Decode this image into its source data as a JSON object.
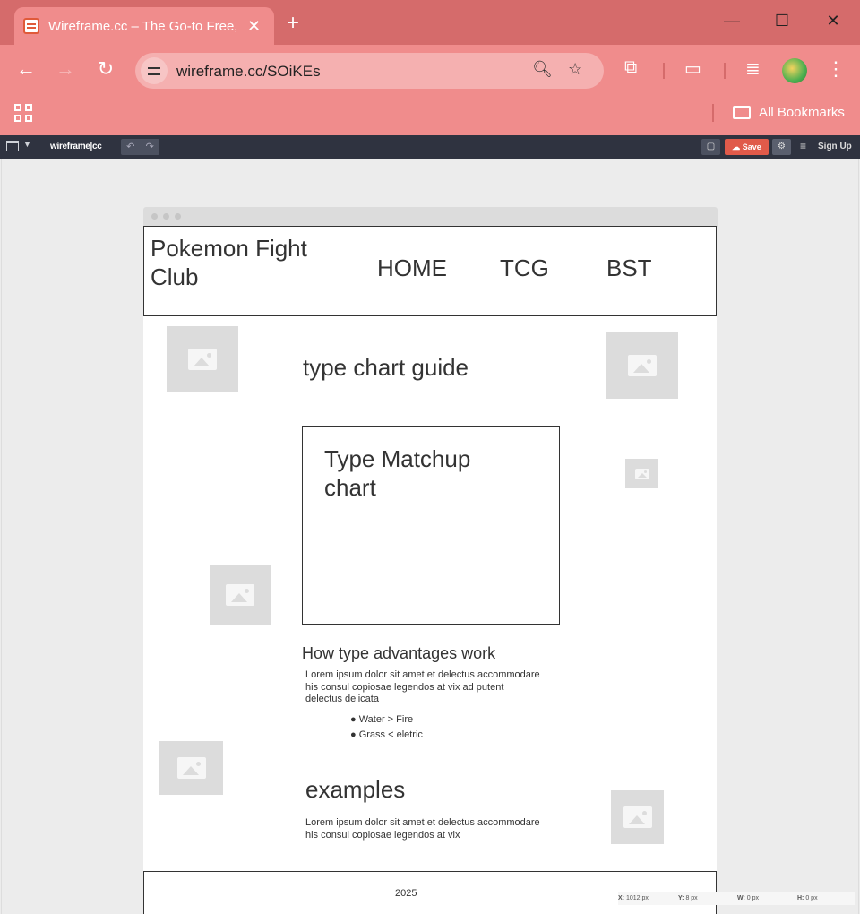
{
  "browser": {
    "tab_title": "Wireframe.cc – The Go-to Free, ",
    "tab_close": "✕",
    "new_tab": "+",
    "url": "wireframe.cc/SOiKEs",
    "bookmarks_label": "All Bookmarks",
    "window_controls": {
      "minimize": "—",
      "maximize": "☐",
      "close": "✕"
    }
  },
  "appbar": {
    "logo": "wireframe|cc",
    "undo": "↶",
    "redo": "↷",
    "save_label": "Save",
    "menu_icon": "≡",
    "signup_label": "Sign Up"
  },
  "wireframe": {
    "site_title": "Pokemon Fight Club",
    "nav": [
      "HOME",
      "TCG",
      "BST"
    ],
    "guide_heading": "type chart guide",
    "chart_box_title": "Type Matchup chart",
    "advantages_heading": "How type advantages work",
    "advantages_paragraph": "Lorem ipsum dolor sit amet et delectus accommodare his consul copiosae legendos at vix ad putent delectus delicata",
    "bullets": [
      "● Water > Fire",
      "● Grass < eletric"
    ],
    "examples_heading": "examples",
    "examples_paragraph": "Lorem ipsum dolor sit amet et delectus accommodare his consul copiosae legendos at vix",
    "footer_text": "2025"
  },
  "status": {
    "x_label": "X:",
    "x_value": "1012 px",
    "y_label": "Y:",
    "y_value": "8 px",
    "w_label": "W:",
    "w_value": "0 px",
    "h_label": "H:",
    "h_value": "0 px"
  },
  "colors": {
    "chrome_dark": "#d56b6b",
    "chrome_light": "#f08c8c",
    "appbar": "#2f3340",
    "save_button": "#e05a4a",
    "placeholder": "#dcdcdc"
  }
}
